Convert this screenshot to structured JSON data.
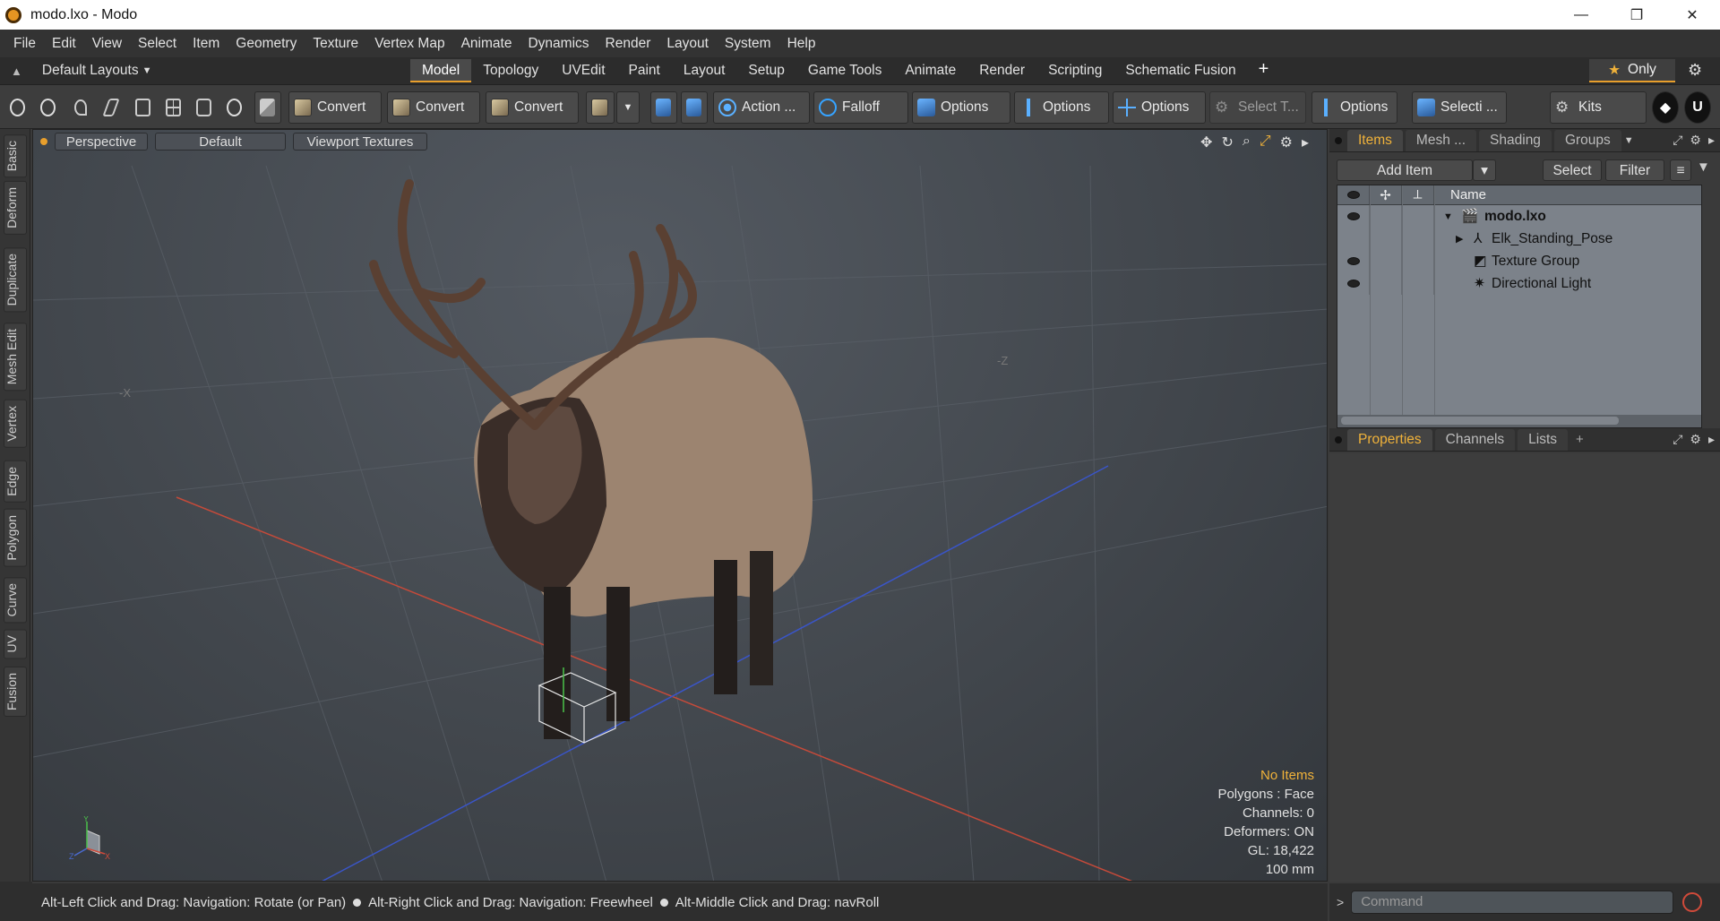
{
  "window": {
    "title": "modo.lxo - Modo",
    "minimize": "—",
    "maximize": "❐",
    "close": "✕"
  },
  "menu": [
    "File",
    "Edit",
    "View",
    "Select",
    "Item",
    "Geometry",
    "Texture",
    "Vertex Map",
    "Animate",
    "Dynamics",
    "Render",
    "Layout",
    "System",
    "Help"
  ],
  "layouts": {
    "label": "Default Layouts"
  },
  "mode_tabs": [
    "Model",
    "Topology",
    "UVEdit",
    "Paint",
    "Layout",
    "Setup",
    "Game Tools",
    "Animate",
    "Render",
    "Scripting",
    "Schematic Fusion"
  ],
  "active_mode": "Model",
  "only_label": "Only",
  "toolbar": {
    "convert1": "Convert",
    "convert2": "Convert",
    "convert3": "Convert",
    "action": "Action ...",
    "falloff": "Falloff",
    "options1": "Options",
    "options2": "Options",
    "options3": "Options",
    "select_t": "Select T...",
    "options4": "Options",
    "selecti": "Selecti ...",
    "kits": "Kits"
  },
  "left_tabs": [
    "Basic",
    "Deform",
    "Duplicate",
    "Mesh Edit",
    "Vertex",
    "Edge",
    "Polygon",
    "Curve",
    "UV",
    "Fusion"
  ],
  "viewport": {
    "view": "Perspective",
    "shading": "Default",
    "textures": "Viewport Textures",
    "info": {
      "items": "No Items",
      "polygons": "Polygons : Face",
      "channels": "Channels: 0",
      "deformers": "Deformers: ON",
      "gl": "GL: 18,422",
      "unit": "100 mm"
    },
    "axis_labels": {
      "y": "Y",
      "x": "X",
      "z": "Z",
      "neg_x": "-X",
      "neg_z": "-Z"
    }
  },
  "items_panel": {
    "tabs": [
      "Items",
      "Mesh ...",
      "Shading",
      "Groups"
    ],
    "add_item": "Add Item",
    "select": "Select",
    "filter": "Filter",
    "column_name": "Name",
    "tree": [
      {
        "name": "modo.lxo",
        "icon": "scene-icon",
        "visible": true
      },
      {
        "name": "Elk_Standing_Pose",
        "icon": "locator-icon",
        "visible": false
      },
      {
        "name": "Texture Group",
        "icon": "group-icon",
        "visible": true
      },
      {
        "name": "Directional Light",
        "icon": "light-icon",
        "visible": true
      }
    ]
  },
  "props_panel": {
    "tabs": [
      "Properties",
      "Channels",
      "Lists"
    ]
  },
  "status": {
    "hint1": "Alt-Left Click and Drag: Navigation: Rotate (or Pan)",
    "hint2": "Alt-Right Click and Drag: Navigation: Freewheel",
    "hint3": "Alt-Middle Click and Drag: navRoll"
  },
  "command": {
    "placeholder": "Command"
  },
  "colors": {
    "accent": "#e89f2c",
    "viewport": "#42474d"
  }
}
